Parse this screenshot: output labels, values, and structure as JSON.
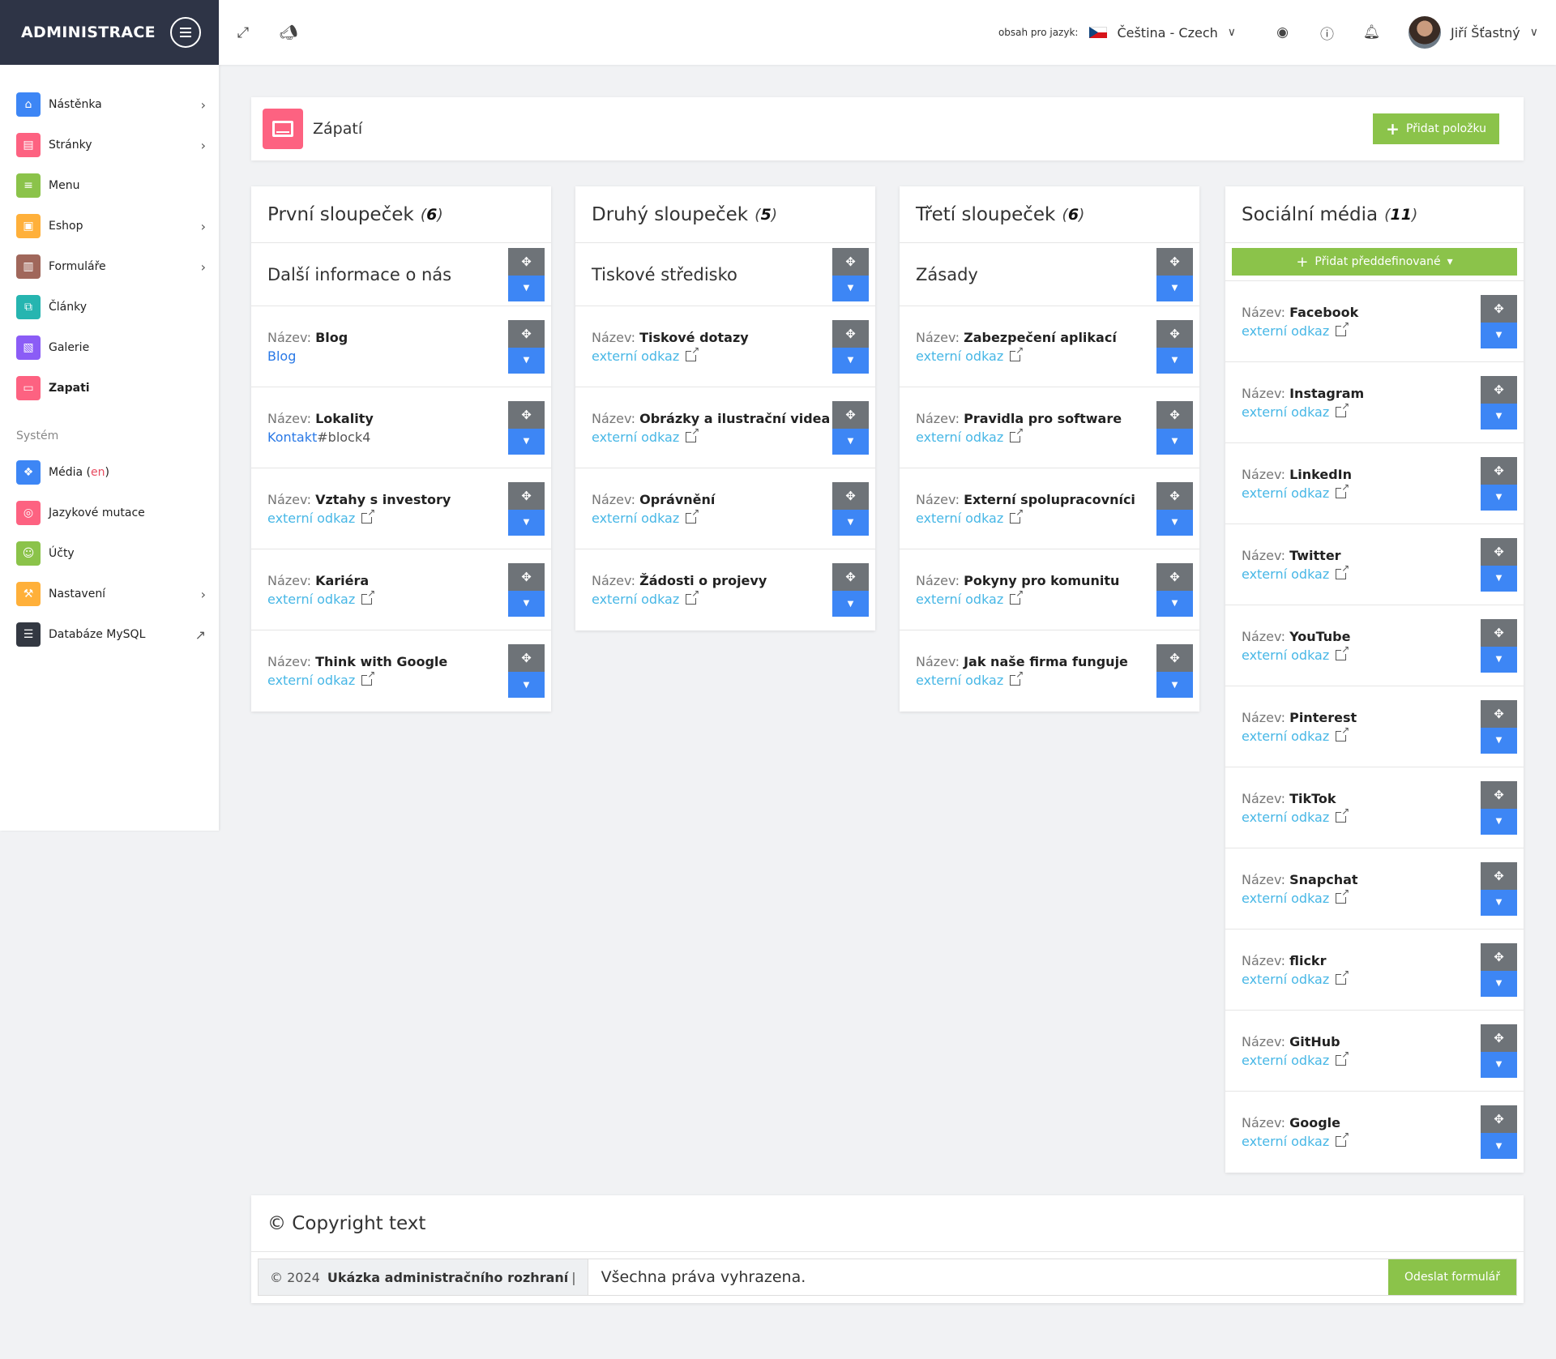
{
  "sidebar": {
    "brand": "ADMINISTRACE",
    "items": [
      {
        "label": "Nástěnka",
        "icon": "home-icon",
        "color": "#3d86f5",
        "arrow": true
      },
      {
        "label": "Stránky",
        "icon": "browser-icon",
        "color": "#fd6281",
        "arrow": true
      },
      {
        "label": "Menu",
        "icon": "menu-icon",
        "color": "#8bc34a",
        "arrow": false
      },
      {
        "label": "Eshop",
        "icon": "cart-icon",
        "color": "#ffb03a",
        "arrow": true
      },
      {
        "label": "Formuláře",
        "icon": "form-icon",
        "color": "#a0675b",
        "arrow": true
      },
      {
        "label": "Články",
        "icon": "articles-icon",
        "color": "#26b5b0",
        "arrow": false
      },
      {
        "label": "Galerie",
        "icon": "gallery-icon",
        "color": "#8b5cf6",
        "arrow": false
      },
      {
        "label": "Zapati",
        "icon": "footer-icon",
        "color": "#fd6281",
        "arrow": false
      }
    ],
    "section": "Systém",
    "system_items": [
      {
        "label": "Média",
        "suffix_open": " (",
        "suffix": "en",
        "suffix_close": ")",
        "icon": "dropbox-icon",
        "color": "#3d86f5",
        "arrow": false
      },
      {
        "label": "Jazykové mutace",
        "icon": "globe-icon",
        "color": "#fd6281",
        "arrow": false
      },
      {
        "label": "Účty",
        "icon": "user-icon",
        "color": "#8bc34a",
        "arrow": false
      },
      {
        "label": "Nastavení",
        "icon": "tools-icon",
        "color": "#ffb03a",
        "arrow": true
      },
      {
        "label": "Databáze MySQL",
        "icon": "database-icon",
        "color": "#333842",
        "arrow": false
      }
    ]
  },
  "topbar": {
    "lang_label": "obsah pro jazyk:",
    "lang_value": "Čeština - Czech",
    "user": "Jiří Šťastný"
  },
  "header": {
    "title": "Zápatí",
    "add_button": "Přidat položku"
  },
  "labels": {
    "name_prefix": "Název: ",
    "external": "externí odkaz"
  },
  "columns": [
    {
      "title": "První sloupeček",
      "count": "6",
      "sub": "Další informace o nás",
      "items": [
        {
          "name": "Blog",
          "link": "Blog",
          "link_type": "internal"
        },
        {
          "name": "Lokality",
          "link": "Kontakt",
          "link_suffix": "#block4",
          "link_type": "internal"
        },
        {
          "name": "Vztahy s investory",
          "link_type": "external"
        },
        {
          "name": "Kariéra",
          "link_type": "external"
        },
        {
          "name": "Think with Google",
          "link_type": "external"
        }
      ]
    },
    {
      "title": "Druhý sloupeček",
      "count": "5",
      "sub": "Tiskové středisko",
      "items": [
        {
          "name": "Tiskové dotazy",
          "link_type": "external"
        },
        {
          "name": "Obrázky a ilustrační videa",
          "link_type": "external"
        },
        {
          "name": "Oprávnění",
          "link_type": "external"
        },
        {
          "name": "Žádosti o projevy",
          "link_type": "external"
        }
      ]
    },
    {
      "title": "Třetí sloupeček",
      "count": "6",
      "sub": "Zásady",
      "items": [
        {
          "name": "Zabezpečení aplikací",
          "link_type": "external"
        },
        {
          "name": "Pravidla pro software",
          "link_type": "external"
        },
        {
          "name": "Externí spolupracovníci",
          "link_type": "external"
        },
        {
          "name": "Pokyny pro komunitu",
          "link_type": "external"
        },
        {
          "name": "Jak naše firma funguje",
          "link_type": "external"
        }
      ]
    },
    {
      "title": "Sociální média",
      "count": "11",
      "predef_button": "Přidat předdefinované",
      "items": [
        {
          "name": "Facebook",
          "link_type": "external"
        },
        {
          "name": "Instagram",
          "link_type": "external"
        },
        {
          "name": "LinkedIn",
          "link_type": "external"
        },
        {
          "name": "Twitter",
          "link_type": "external"
        },
        {
          "name": "YouTube",
          "link_type": "external"
        },
        {
          "name": "Pinterest",
          "link_type": "external"
        },
        {
          "name": "TikTok",
          "link_type": "external"
        },
        {
          "name": "Snapchat",
          "link_type": "external"
        },
        {
          "name": "flickr",
          "link_type": "external"
        },
        {
          "name": "GitHub",
          "link_type": "external"
        },
        {
          "name": "Google",
          "link_type": "external"
        }
      ]
    }
  ],
  "copyright": {
    "title": "© Copyright text",
    "prefix_year": "© 2024",
    "prefix_name": "Ukázka administračního rozhraní",
    "prefix_sep": "|",
    "value": "Všechna práva vyhrazena.",
    "submit": "Odeslat formulář"
  }
}
